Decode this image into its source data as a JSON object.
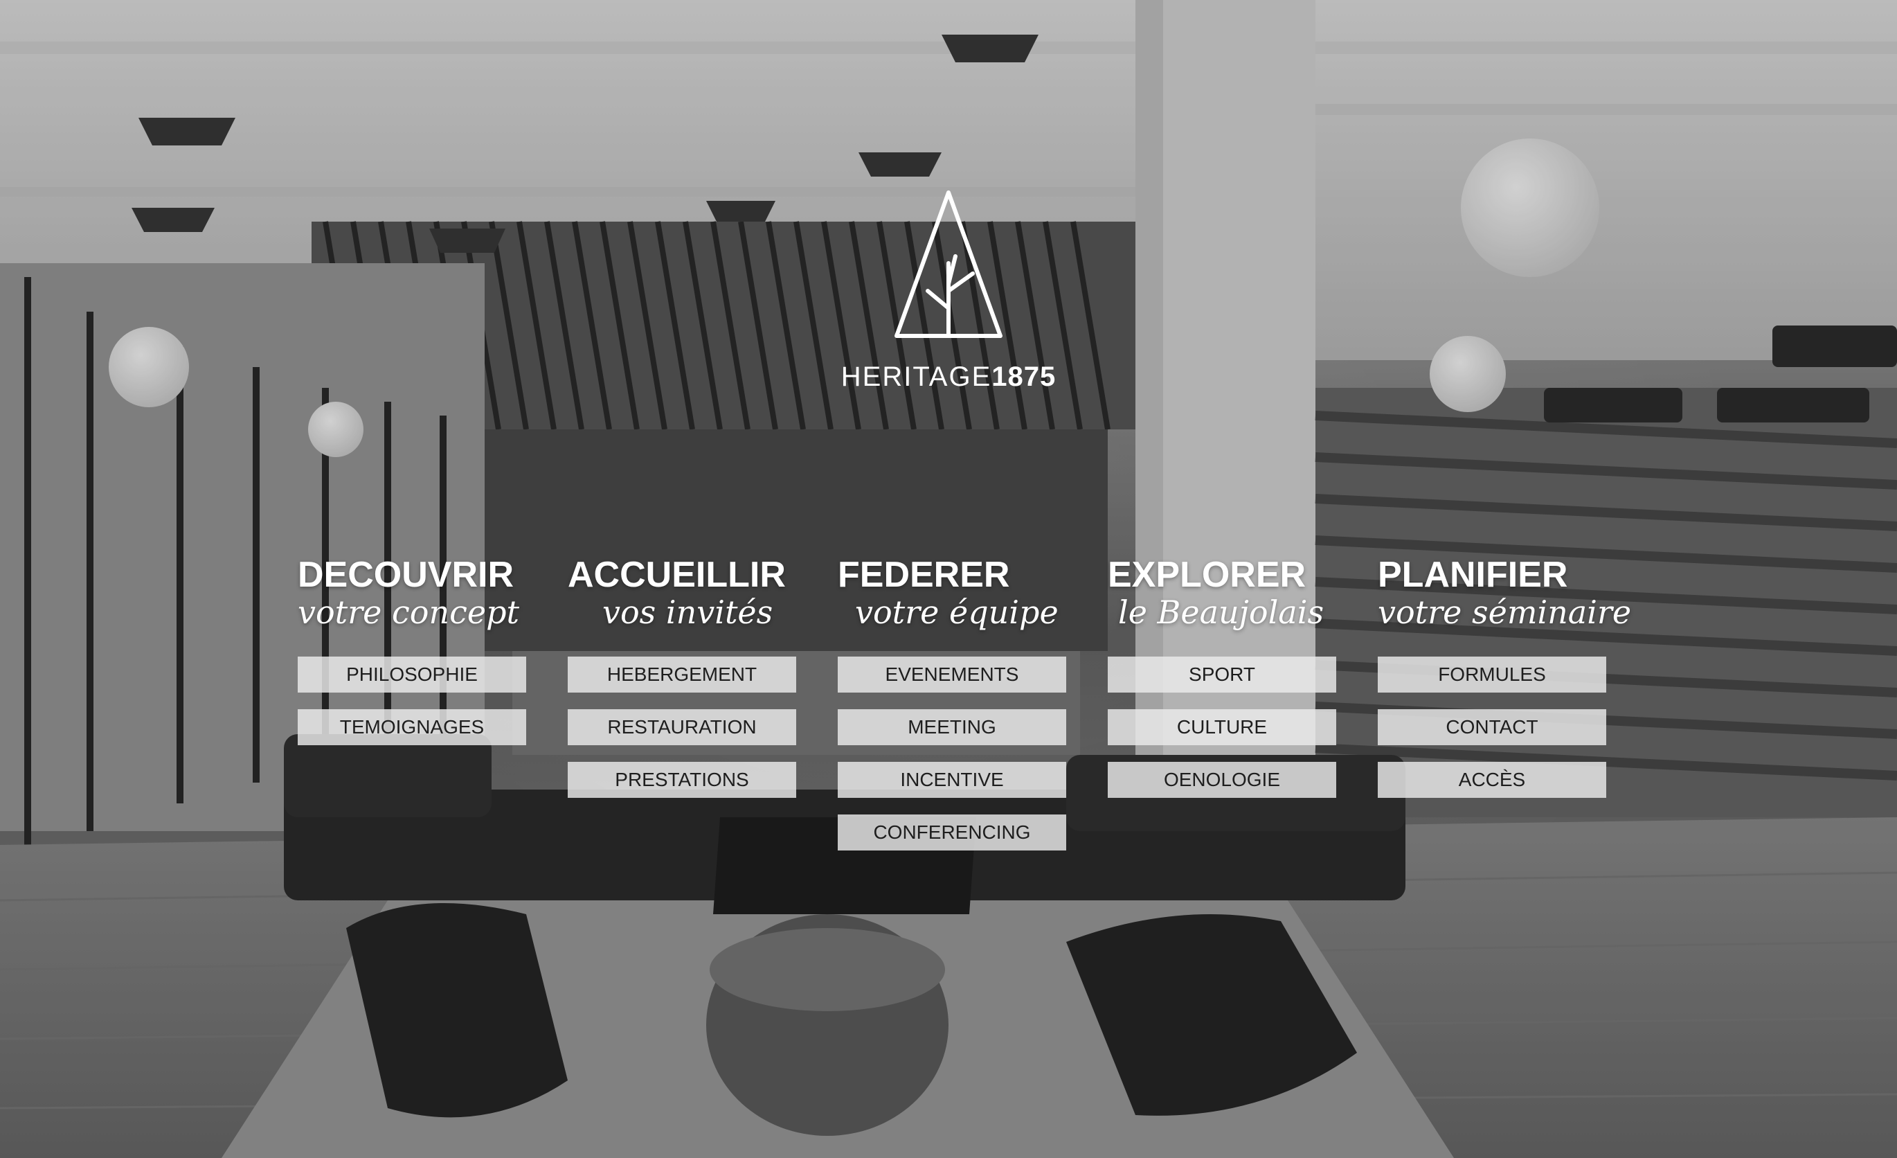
{
  "brand": {
    "name_light": "HERITAGE",
    "name_bold": "1875",
    "logo_icon": "tree-triangle-icon"
  },
  "menu": {
    "columns": [
      {
        "title": "DECOUVRIR",
        "subtitle": "votre concept",
        "items": [
          "PHILOSOPHIE",
          "TEMOIGNAGES"
        ]
      },
      {
        "title": "ACCUEILLIR",
        "subtitle": "vos invités",
        "items": [
          "HEBERGEMENT",
          "RESTAURATION",
          "PRESTATIONS"
        ]
      },
      {
        "title": "FEDERER",
        "subtitle": "votre équipe",
        "items": [
          "EVENEMENTS",
          "MEETING",
          "INCENTIVE",
          "CONFERENCING"
        ]
      },
      {
        "title": "EXPLORER",
        "subtitle": "le Beaujolais",
        "items": [
          "SPORT",
          "CULTURE",
          "OENOLOGIE"
        ]
      },
      {
        "title": "PLANIFIER",
        "subtitle": "votre séminaire",
        "items": [
          "FORMULES",
          "CONTACT",
          "ACCÈS"
        ]
      }
    ]
  },
  "colors": {
    "menu_item_bg": "#ebebeb",
    "menu_item_text": "#1e1e1e",
    "heading_text": "#ffffff"
  }
}
